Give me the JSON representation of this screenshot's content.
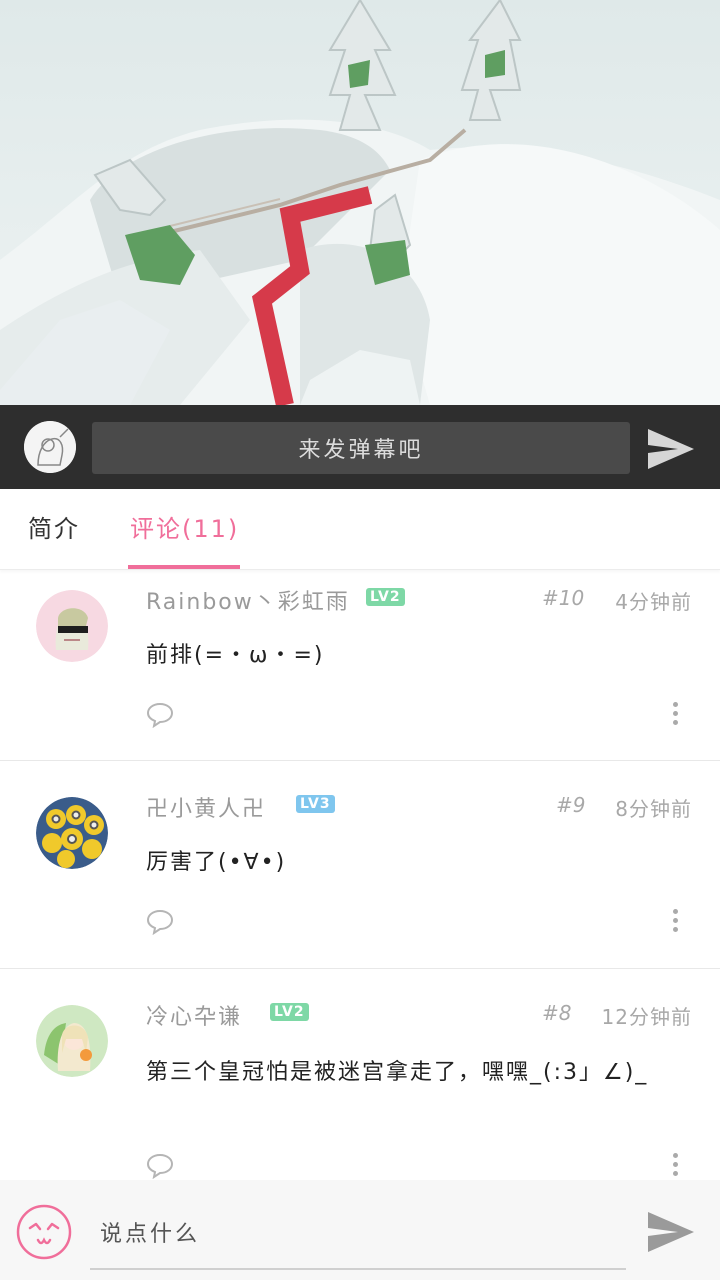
{
  "danmaku": {
    "placeholder": "来发弹幕吧"
  },
  "tabs": [
    {
      "label": "简介",
      "active": false
    },
    {
      "label": "评论(11)",
      "active": true
    }
  ],
  "comments": [
    {
      "user": "Rainbow丶彩虹雨",
      "level": "LV2",
      "floor": "#10",
      "time": "4分钟前",
      "text": "前排(=・ω・=)"
    },
    {
      "user": "卍小黄人卍",
      "level": "LV3",
      "floor": "#9",
      "time": "8分钟前",
      "text": "厉害了(•∀•)"
    },
    {
      "user": "冷心卆谦",
      "level": "LV2",
      "floor": "#8",
      "time": "12分钟前",
      "text": "第三个皇冠怕是被迷宫拿走了，嘿嘿_(:3」∠)_"
    }
  ],
  "composer": {
    "placeholder": "说点什么"
  },
  "colors": {
    "accent": "#f06e9a",
    "danmaku_bar": "#2e2e2e",
    "level2": "#7ed8a6",
    "level3": "#7fc6ee"
  },
  "icons": {
    "send": "paper-plane-icon",
    "reply": "speech-bubble-icon",
    "more": "vertical-dots-icon",
    "emoji": "smiley-face-icon"
  }
}
